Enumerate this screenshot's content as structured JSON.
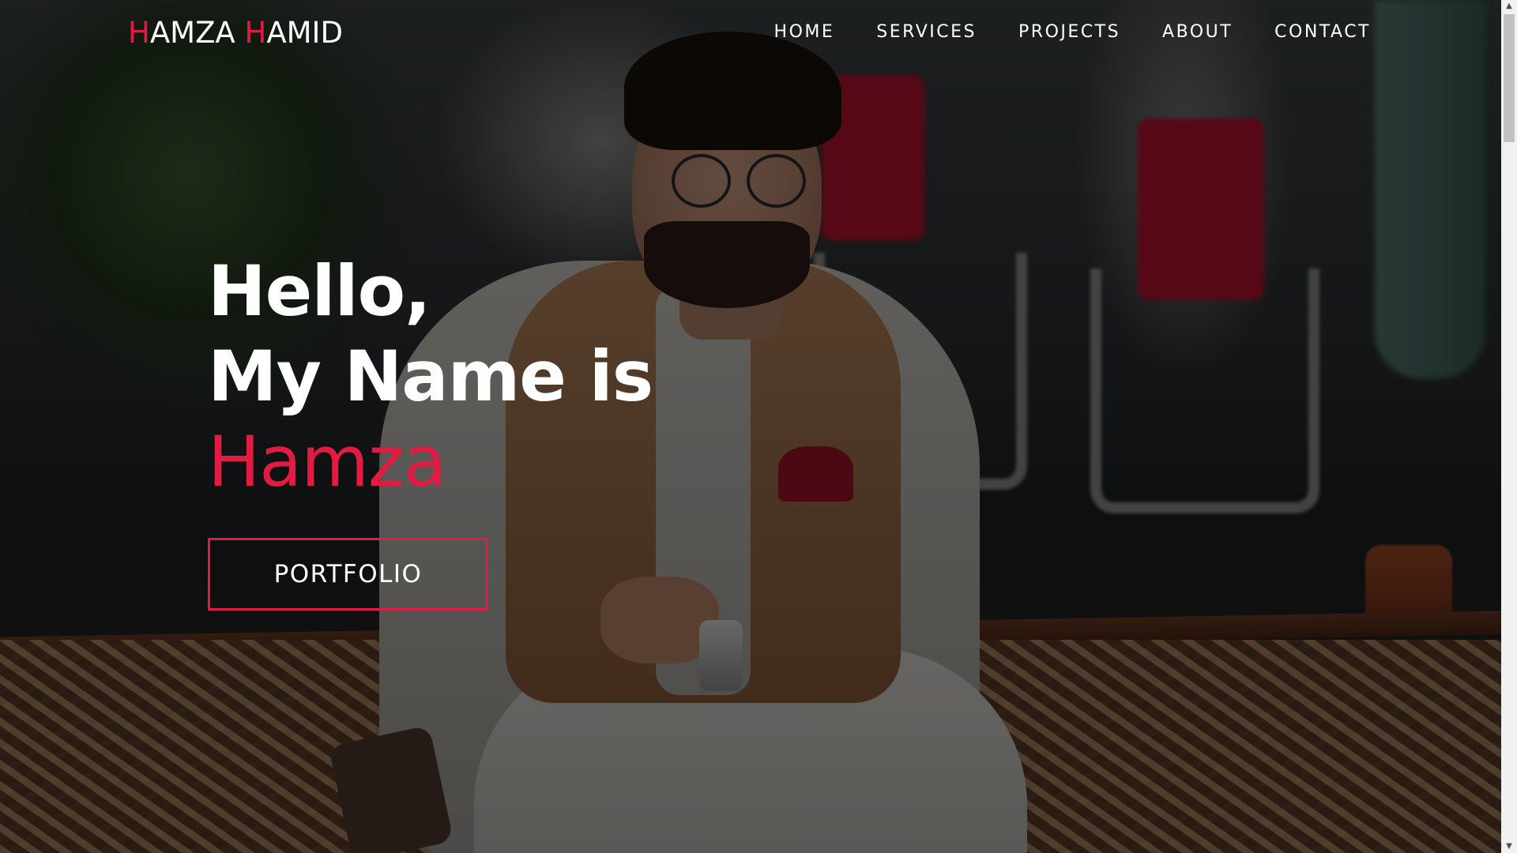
{
  "brand": {
    "logo_first_initial": "H",
    "logo_first_rest": "AMZA ",
    "logo_last_initial": "H",
    "logo_last_rest": "AMID"
  },
  "nav": {
    "items": [
      {
        "label": "HOME"
      },
      {
        "label": "SERVICES"
      },
      {
        "label": "PROJECTS"
      },
      {
        "label": "ABOUT"
      },
      {
        "label": "CONTACT"
      }
    ]
  },
  "hero": {
    "greeting": "Hello,",
    "intro": "My Name is",
    "name": "Hamza",
    "cta_label": "PORTFOLIO"
  },
  "colors": {
    "accent": "#e31b43",
    "text": "#ffffff"
  },
  "icons": {
    "scroll_up": "scroll-up-arrow-icon",
    "scroll_down": "scroll-down-arrow-icon"
  }
}
